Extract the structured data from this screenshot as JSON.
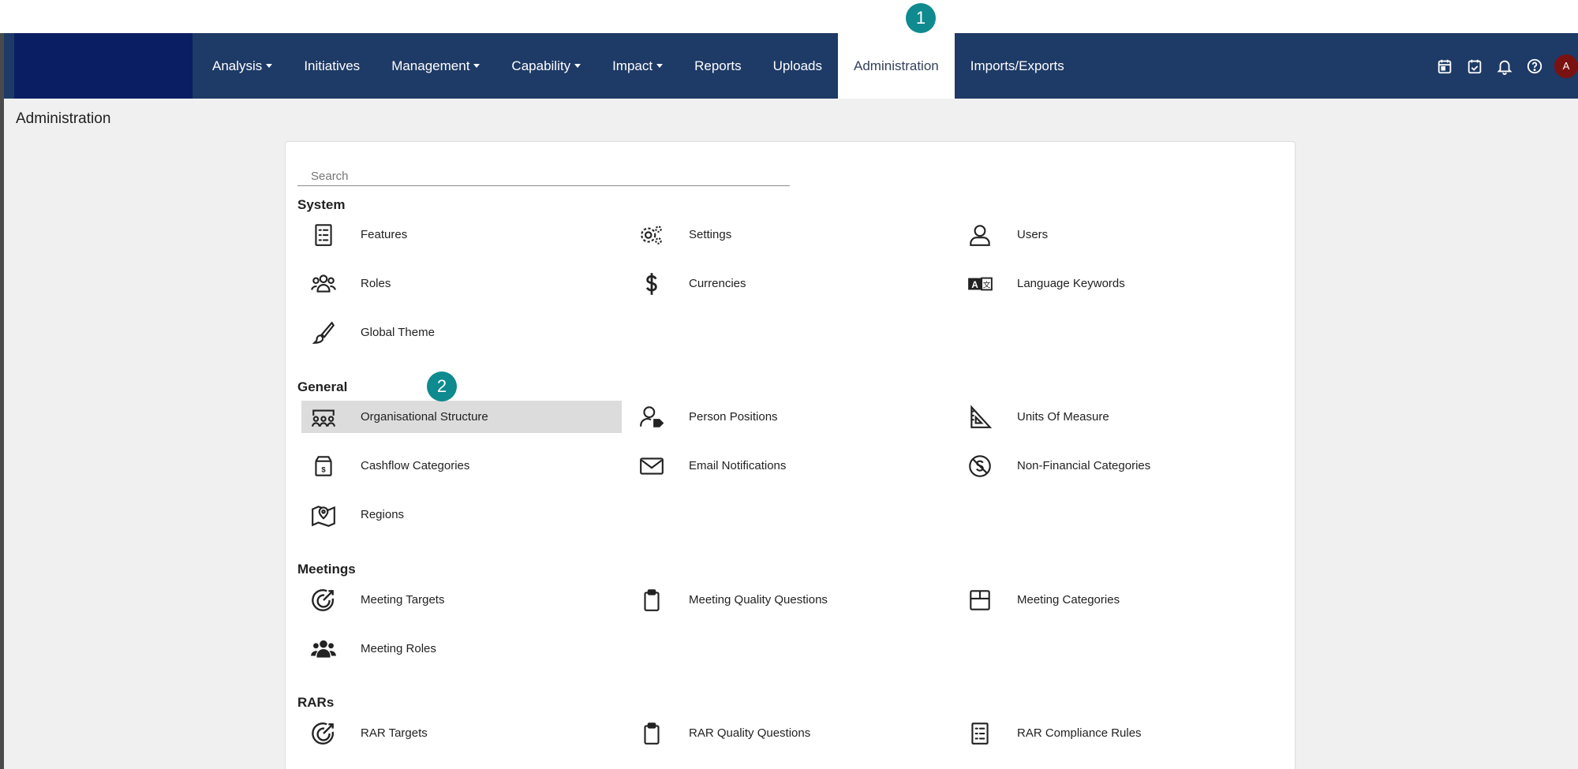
{
  "tutorial_markers": [
    "1",
    "2"
  ],
  "navbar": {
    "items": [
      {
        "label": "Analysis",
        "dropdown": true
      },
      {
        "label": "Initiatives",
        "dropdown": false
      },
      {
        "label": "Management",
        "dropdown": true
      },
      {
        "label": "Capability",
        "dropdown": true
      },
      {
        "label": "Impact",
        "dropdown": true
      },
      {
        "label": "Reports",
        "dropdown": false
      },
      {
        "label": "Uploads",
        "dropdown": false
      },
      {
        "label": "Administration",
        "dropdown": false,
        "active": true
      },
      {
        "label": "Imports/Exports",
        "dropdown": false
      }
    ],
    "icons": [
      "calendar-icon",
      "calendar-check-icon",
      "bell-icon",
      "help-icon"
    ],
    "avatar": "A",
    "colors": {
      "bar": "#1e3a66",
      "brand": "#0a1f63",
      "avatar": "#7a1212",
      "marker": "#0f8a8f"
    }
  },
  "page": {
    "title": "Administration",
    "search": {
      "placeholder": "Search",
      "value": ""
    }
  },
  "sections": [
    {
      "title": "System",
      "items": [
        {
          "label": "Features",
          "icon": "checklist-icon"
        },
        {
          "label": "Settings",
          "icon": "gears-icon"
        },
        {
          "label": "Users",
          "icon": "user-icon"
        },
        {
          "label": "Roles",
          "icon": "users-group-icon"
        },
        {
          "label": "Currencies",
          "icon": "dollar-icon"
        },
        {
          "label": "Language Keywords",
          "icon": "translate-icon"
        },
        {
          "label": "Global Theme",
          "icon": "brush-icon"
        }
      ]
    },
    {
      "title": "General",
      "items": [
        {
          "label": "Organisational Structure",
          "icon": "org-structure-icon",
          "highlighted": true
        },
        {
          "label": "Person Positions",
          "icon": "person-tag-icon"
        },
        {
          "label": "Units Of Measure",
          "icon": "set-square-icon"
        },
        {
          "label": "Cashflow Categories",
          "icon": "money-box-icon"
        },
        {
          "label": "Email Notifications",
          "icon": "envelope-icon"
        },
        {
          "label": "Non-Financial Categories",
          "icon": "no-dollar-icon"
        },
        {
          "label": "Regions",
          "icon": "map-pin-icon"
        }
      ]
    },
    {
      "title": "Meetings",
      "items": [
        {
          "label": "Meeting Targets",
          "icon": "target-arrow-icon"
        },
        {
          "label": "Meeting Quality Questions",
          "icon": "clipboard-icon"
        },
        {
          "label": "Meeting Categories",
          "icon": "box-icon"
        },
        {
          "label": "Meeting Roles",
          "icon": "people-icon"
        }
      ]
    },
    {
      "title": "RARs",
      "items": [
        {
          "label": "RAR Targets",
          "icon": "target-arrow-icon"
        },
        {
          "label": "RAR Quality Questions",
          "icon": "clipboard-icon"
        },
        {
          "label": "RAR Compliance Rules",
          "icon": "checklist-icon"
        }
      ]
    }
  ]
}
